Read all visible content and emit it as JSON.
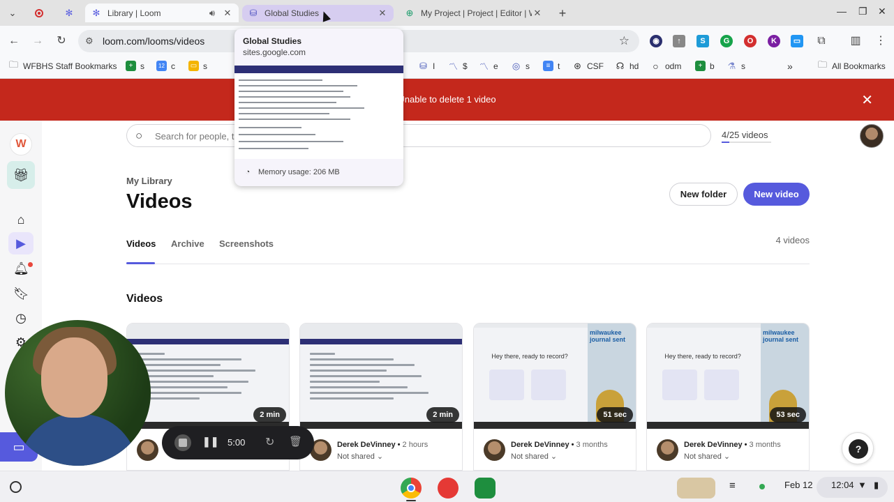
{
  "browser": {
    "tabs": [
      {
        "title": "Library | Loom",
        "state": "active"
      },
      {
        "title": "Global Studies",
        "state": "hovered"
      },
      {
        "title": "My Project | Project | Editor | W",
        "state": "inactive"
      }
    ],
    "url": "loom.com/looms/videos",
    "bookmarks": [
      {
        "label": "WFBHS Staff Bookmarks",
        "icon": "folder-icon"
      },
      {
        "label": "s",
        "icon": "sheets-icon"
      },
      {
        "label": "c",
        "icon": "calendar-icon"
      },
      {
        "label": "s",
        "icon": "slides-icon"
      },
      {
        "label": "I",
        "icon": "site-icon"
      },
      {
        "label": "$",
        "icon": "chart-icon"
      },
      {
        "label": "e",
        "icon": "chart-icon"
      },
      {
        "label": "s",
        "icon": "eye-icon"
      },
      {
        "label": "t",
        "icon": "docs-icon"
      },
      {
        "label": "CSF",
        "icon": "globe-icon"
      },
      {
        "label": "hd",
        "icon": "site-icon"
      },
      {
        "label": "odm",
        "icon": "circle-icon"
      },
      {
        "label": "b",
        "icon": "sheets-icon"
      },
      {
        "label": "s",
        "icon": "flask-icon"
      }
    ],
    "all_bookmarks": "All Bookmarks"
  },
  "hover_card": {
    "title": "Global Studies",
    "url": "sites.google.com",
    "memory": "Memory usage: 206 MB"
  },
  "banner": {
    "message": "Unable to delete 1 video",
    "color": "#c4281c"
  },
  "search": {
    "placeholder": "Search for people, t"
  },
  "quota": {
    "label": "4/25 videos",
    "used": 4,
    "total": 25
  },
  "library": {
    "eyebrow": "My Library",
    "title": "Videos",
    "new_folder": "New folder",
    "new_video": "New video",
    "tabs": [
      "Videos",
      "Archive",
      "Screenshots"
    ],
    "count": "4 videos",
    "section": "Videos",
    "accent": "#565add"
  },
  "videos": [
    {
      "duration": "2 min",
      "author": "",
      "age": "",
      "share": "",
      "thumb": "doc"
    },
    {
      "duration": "2 min",
      "author": "Derek DeVinney",
      "age": "2 hours",
      "share": "Not shared",
      "thumb": "doc"
    },
    {
      "duration": "51 sec",
      "author": "Derek DeVinney",
      "age": "3 months",
      "share": "Not shared",
      "thumb": "record"
    },
    {
      "duration": "53 sec",
      "author": "Derek DeVinney",
      "age": "3 months",
      "share": "Not shared",
      "thumb": "record"
    }
  ],
  "thumb_text": {
    "ready": "Hey there, ready to record?",
    "paper": "milwaukee journal sent"
  },
  "recorder": {
    "timer": "5:00"
  },
  "shelf": {
    "date": "Feb 12",
    "time": "12:04"
  }
}
